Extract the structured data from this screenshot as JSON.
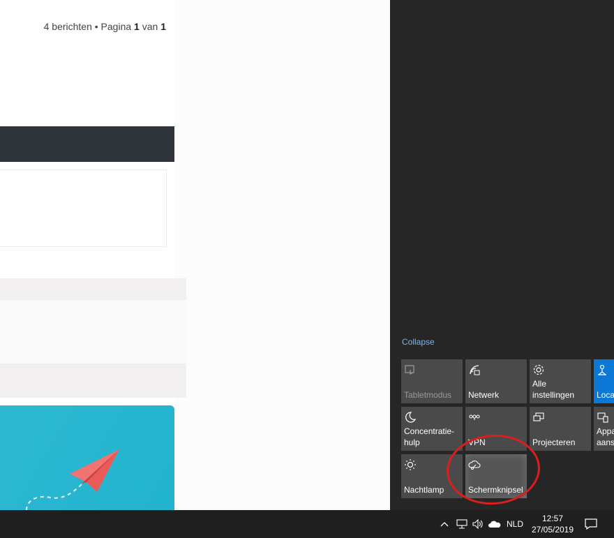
{
  "page": {
    "pagination": {
      "count_text": "4 berichten • Pagina ",
      "current_page": "1",
      "of_text": " van ",
      "total_pages": "1"
    }
  },
  "action_center": {
    "collapse_label": "Collapse",
    "tiles": [
      {
        "label": "Tabletmodus",
        "icon": "tablet-mode-icon",
        "state": "disabled"
      },
      {
        "label": "Netwerk",
        "icon": "network-icon",
        "state": "off"
      },
      {
        "label": "Alle\ninstellingen",
        "icon": "gear-icon",
        "state": "off"
      },
      {
        "label": "Loca",
        "icon": "location-icon",
        "state": "on"
      },
      {
        "label": "Concentratie-\nhulp",
        "icon": "moon-icon",
        "state": "off"
      },
      {
        "label": "VPN",
        "icon": "vpn-icon",
        "state": "off"
      },
      {
        "label": "Projecteren",
        "icon": "project-icon",
        "state": "off"
      },
      {
        "label": "Appa\naansl",
        "icon": "devices-icon",
        "state": "off"
      },
      {
        "label": "Nachtlamp",
        "icon": "sun-icon",
        "state": "off"
      },
      {
        "label": "Schermknipsel",
        "icon": "snip-icon",
        "state": "hover"
      }
    ]
  },
  "taskbar": {
    "language": "NLD",
    "time": "12:57",
    "date": "27/05/2019",
    "tray_icons": [
      "chevron-up-icon",
      "network-icon",
      "volume-icon",
      "onedrive-icon",
      "notifications-icon"
    ]
  },
  "colors": {
    "accent": "#0a78d4",
    "annotation": "#d91e1e",
    "link": "#7fb5e8"
  }
}
